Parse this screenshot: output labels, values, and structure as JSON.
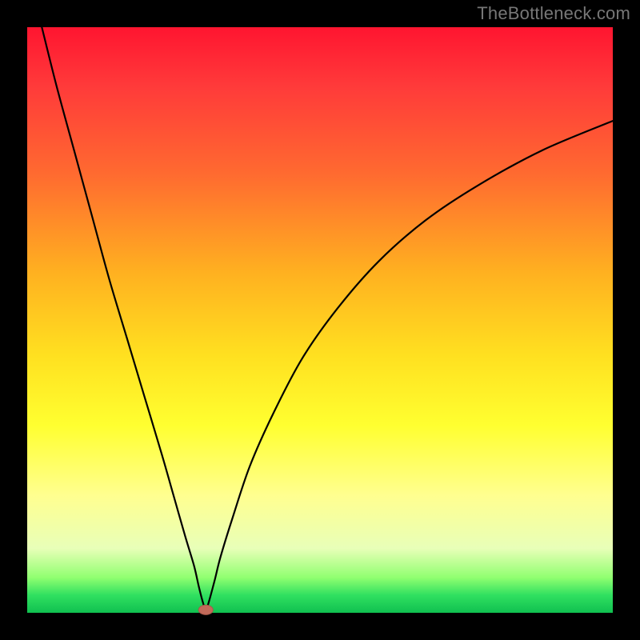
{
  "attribution": "TheBottleneck.com",
  "colors": {
    "frame": "#000000",
    "curve": "#000000",
    "marker_fill": "#c26a5a",
    "marker_stroke": "#a85848",
    "gradient_stops": [
      "#ff1530",
      "#ff3a3a",
      "#ff6a30",
      "#ffb120",
      "#ffe020",
      "#ffff30",
      "#ffff90",
      "#e8ffb8",
      "#90ff70",
      "#30e060",
      "#10c050"
    ]
  },
  "chart_data": {
    "type": "line",
    "title": "",
    "xlabel": "",
    "ylabel": "",
    "xlim": [
      0,
      100
    ],
    "ylim": [
      0,
      100
    ],
    "legend": false,
    "grid": false,
    "marker": {
      "x": 30.5,
      "y": 0.5
    },
    "series": [
      {
        "name": "curve",
        "x": [
          2.5,
          5,
          8,
          11,
          14,
          17,
          20,
          23,
          25,
          27,
          28.5,
          29.3,
          30,
          30.5,
          31,
          32,
          33,
          35,
          38,
          42,
          47,
          53,
          60,
          68,
          77,
          88,
          100
        ],
        "y": [
          100,
          90,
          79,
          68,
          57,
          47,
          37,
          27,
          20,
          13,
          8,
          4.5,
          1.8,
          0.5,
          1.8,
          5.5,
          9.5,
          16,
          25,
          34,
          43.5,
          52,
          60,
          67,
          73,
          79,
          84
        ]
      }
    ]
  }
}
